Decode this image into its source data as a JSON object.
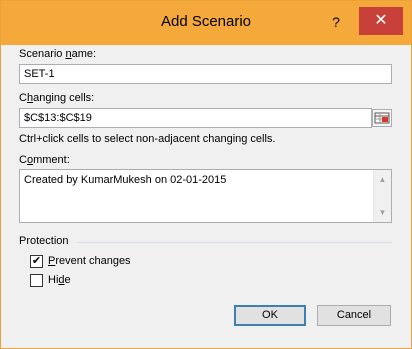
{
  "window": {
    "title": "Add Scenario",
    "help_glyph": "?",
    "close_glyph": "✕"
  },
  "scenario_name": {
    "label_pre": "Scenario ",
    "label_u": "n",
    "label_post": "ame:",
    "value": "SET-1"
  },
  "changing_cells": {
    "label_pre": "C",
    "label_u": "h",
    "label_post": "anging cells:",
    "value": "$C$13:$C$19",
    "hint": "Ctrl+click cells to select non-adjacent changing cells.",
    "refedit_icon": "collapse-dialog-icon"
  },
  "comment": {
    "label_pre": "C",
    "label_u": "o",
    "label_post": "mment:",
    "value": "Created by KumarMukesh on 02-01-2015"
  },
  "protection": {
    "group_label": "Protection",
    "prevent": {
      "label_u": "P",
      "label_post": "revent changes",
      "checked": true,
      "check_glyph": "✔"
    },
    "hide": {
      "label_pre": "Hi",
      "label_u": "d",
      "label_post": "e",
      "checked": false
    }
  },
  "buttons": {
    "ok": "OK",
    "cancel": "Cancel"
  },
  "scroll": {
    "up_glyph": "▲",
    "down_glyph": "▼"
  }
}
